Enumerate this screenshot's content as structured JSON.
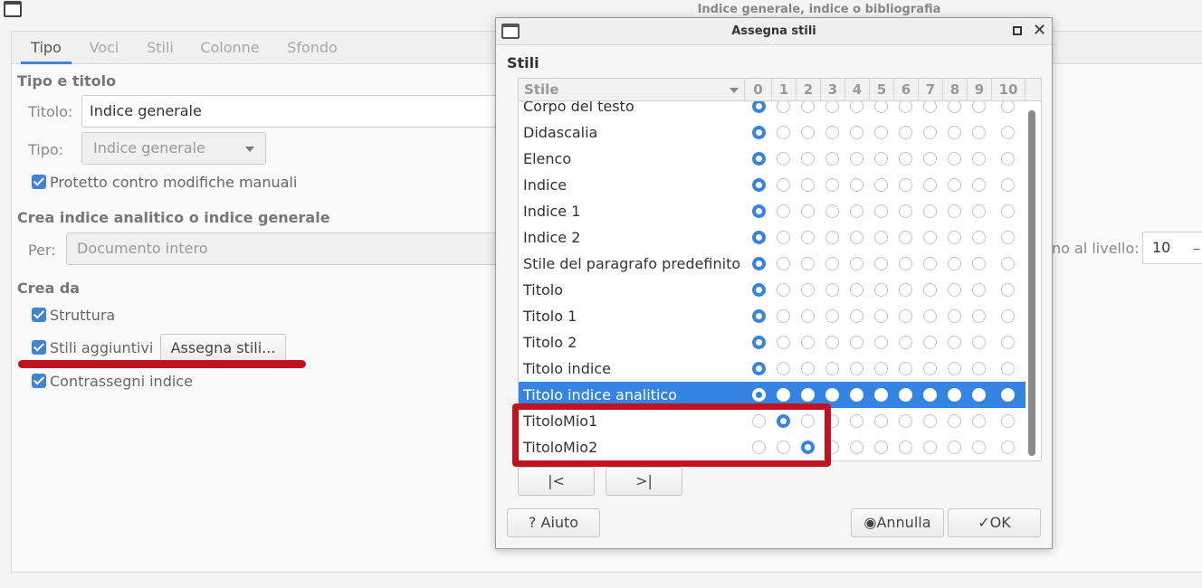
{
  "main": {
    "window_title": "Indice generale, indice o bibliografia",
    "tabs": [
      {
        "label": "Tipo",
        "active": true
      },
      {
        "label": "Voci",
        "active": false
      },
      {
        "label": "Stili",
        "active": false
      },
      {
        "label": "Colonne",
        "active": false
      },
      {
        "label": "Sfondo",
        "active": false
      }
    ],
    "section_type_title": "Tipo e titolo",
    "title_label": "Titolo:",
    "title_value": "Indice generale",
    "type_label": "Tipo:",
    "type_value": "Indice generale",
    "protected_label": "Protetto contro modifiche manuali",
    "section_create_index": "Crea indice analitico o indice generale",
    "for_label": "Per:",
    "for_value": "Documento intero",
    "level_label": "no al livello:",
    "level_value": "10",
    "level_minus": "–",
    "section_create_from": "Crea da",
    "structure_label": "Struttura",
    "additional_styles_label": "Stili aggiuntivi",
    "assign_styles_button": "Assegna stili...",
    "index_marks_label": "Contrassegni indice",
    "annotation_color": "#c1121f",
    "accent_color": "#3584e4"
  },
  "dialog": {
    "title": "Assegna stili",
    "section_title": "Stili",
    "column_style": "Stile",
    "level_columns": [
      "0",
      "1",
      "2",
      "3",
      "4",
      "5",
      "6",
      "7",
      "8",
      "9",
      "10"
    ],
    "rows": [
      {
        "name": "Corpo del testo",
        "level": 0,
        "selected": false
      },
      {
        "name": "Didascalia",
        "level": 0,
        "selected": false
      },
      {
        "name": "Elenco",
        "level": 0,
        "selected": false
      },
      {
        "name": "Indice",
        "level": 0,
        "selected": false
      },
      {
        "name": "Indice 1",
        "level": 0,
        "selected": false
      },
      {
        "name": "Indice 2",
        "level": 0,
        "selected": false
      },
      {
        "name": "Stile del paragrafo predefinito",
        "level": 0,
        "selected": false
      },
      {
        "name": "Titolo",
        "level": 0,
        "selected": false
      },
      {
        "name": "Titolo 1",
        "level": 0,
        "selected": false
      },
      {
        "name": "Titolo 2",
        "level": 0,
        "selected": false
      },
      {
        "name": "Titolo indice",
        "level": 0,
        "selected": false
      },
      {
        "name": "Titolo indice analitico",
        "level": 0,
        "selected": true
      },
      {
        "name": "TitoloMio1",
        "level": 1,
        "selected": false
      },
      {
        "name": "TitoloMio2",
        "level": 2,
        "selected": false
      }
    ],
    "move_left_icon": "arrow-left-bar-icon",
    "move_right_icon": "arrow-right-bar-icon",
    "move_left_glyph": "|<",
    "move_right_glyph": ">|",
    "help_button": "Aiuto",
    "help_glyph": "?",
    "cancel_button": "Annulla",
    "cancel_glyph": "◉",
    "ok_button": "OK",
    "ok_glyph": "✓"
  }
}
